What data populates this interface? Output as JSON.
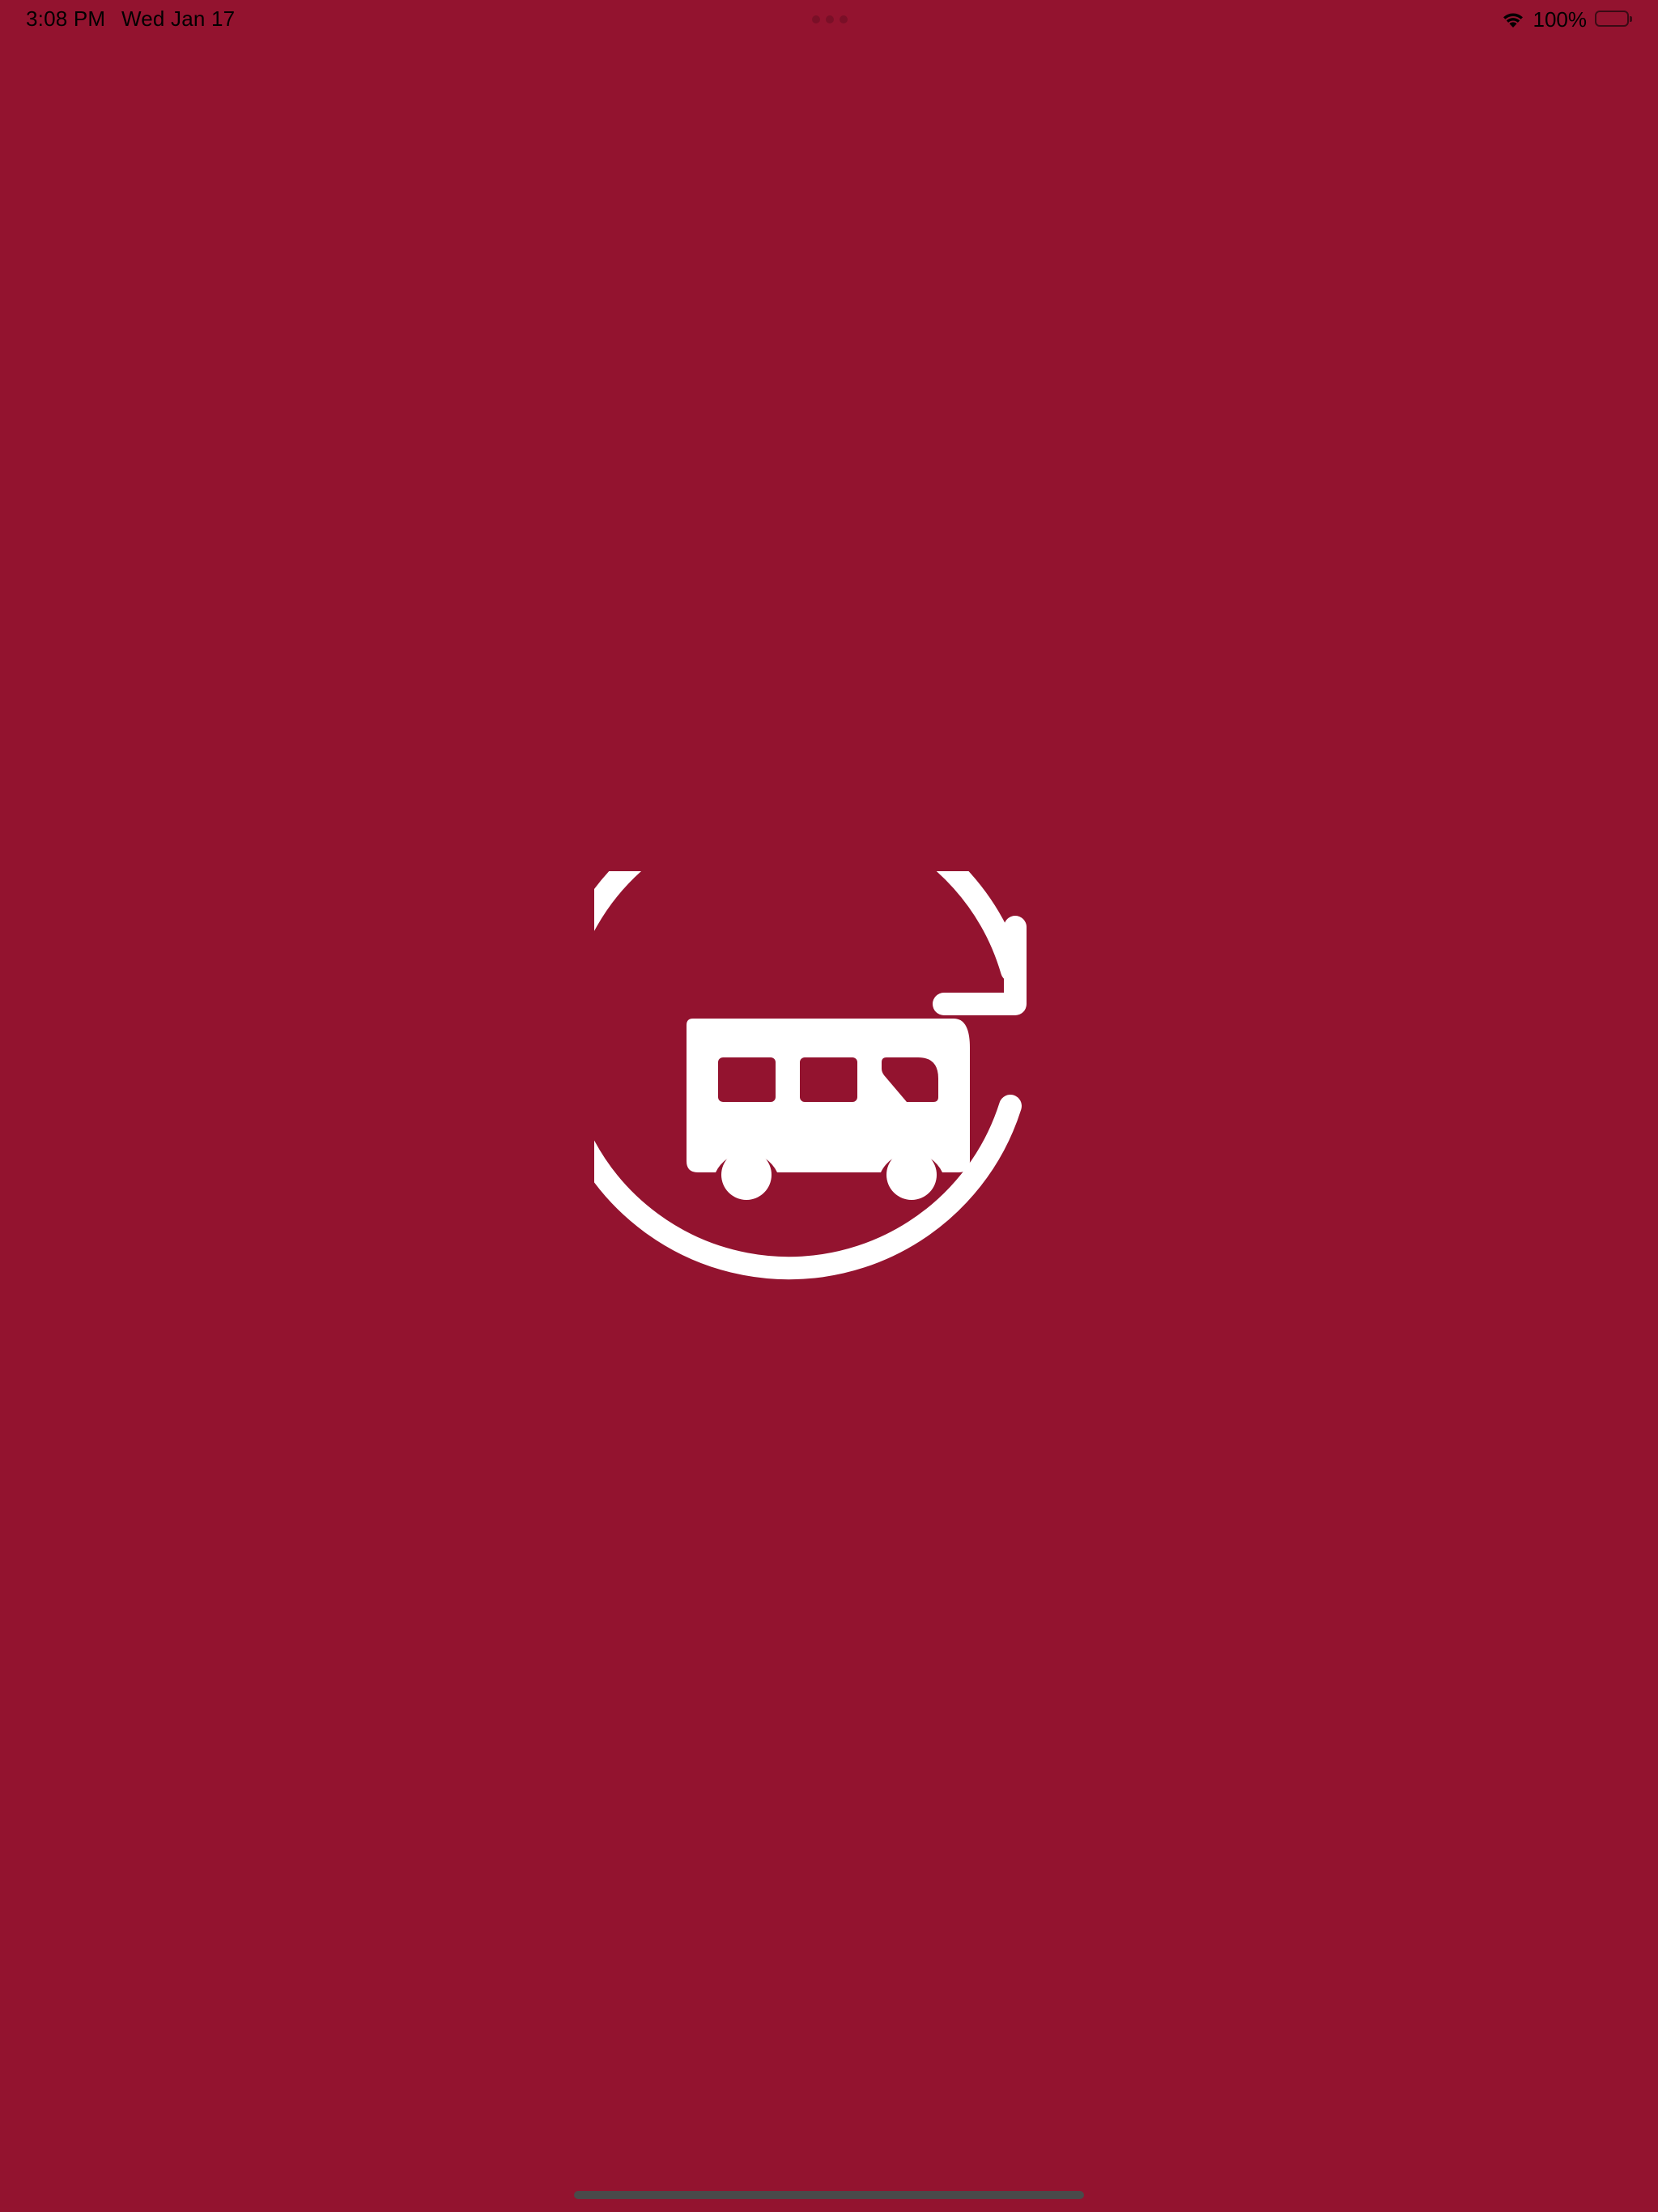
{
  "status_bar": {
    "time": "3:08 PM",
    "date": "Wed Jan 17",
    "battery_percent": "100%",
    "battery_level": 1.0,
    "wifi_icon": "wifi-icon",
    "battery_icon": "battery-icon"
  },
  "splash": {
    "logo_icon": "bus-refresh-icon"
  },
  "colors": {
    "background": "#93132f",
    "logo": "#ffffff",
    "home_indicator": "#4a4a4a"
  }
}
